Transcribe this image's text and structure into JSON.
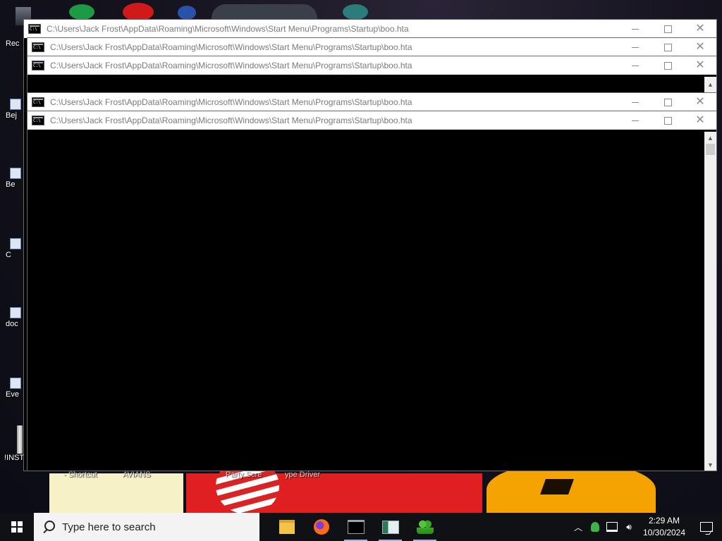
{
  "desktop": {
    "icons": [
      {
        "label": "Rec",
        "icon": "recycle-bin-icon"
      },
      {
        "label": "Bej",
        "icon": "shortcut-icon"
      },
      {
        "label": "Be",
        "icon": "shortcut-icon"
      },
      {
        "label": "C",
        "icon": "shortcut-icon"
      },
      {
        "label": "doc",
        "icon": "shortcut-icon"
      },
      {
        "label": "Eve",
        "icon": "shortcut-icon"
      },
      {
        "label": "!INST",
        "icon": "installer-icon"
      }
    ],
    "wallpaper_labels": [
      "- Shortcut",
      "AVIANS",
      "Party Scre",
      "ype Driver"
    ],
    "colors": {
      "wallpaper_red": "#e02020",
      "pumpkin": "#f5a300",
      "paper": "#f7f1c7"
    }
  },
  "windows": [
    {
      "title": "C:\\Users\\Jack Frost\\AppData\\Roaming\\Microsoft\\Windows\\Start Menu\\Programs\\Startup\\boo.hta"
    },
    {
      "title": "C:\\Users\\Jack Frost\\AppData\\Roaming\\Microsoft\\Windows\\Start Menu\\Programs\\Startup\\boo.hta"
    },
    {
      "title": "C:\\Users\\Jack Frost\\AppData\\Roaming\\Microsoft\\Windows\\Start Menu\\Programs\\Startup\\boo.hta"
    },
    {
      "title": "C:\\Users\\Jack Frost\\AppData\\Roaming\\Microsoft\\Windows\\Start Menu\\Programs\\Startup\\boo.hta"
    },
    {
      "title": "C:\\Users\\Jack Frost\\AppData\\Roaming\\Microsoft\\Windows\\Start Menu\\Programs\\Startup\\boo.hta"
    }
  ],
  "window_controls": {
    "minimize": "minimize-icon",
    "maximize": "maximize-icon",
    "close": "close-icon"
  },
  "taskbar": {
    "search_placeholder": "Type here to search",
    "apps": [
      {
        "name": "file-explorer-icon",
        "running": false
      },
      {
        "name": "firefox-icon",
        "running": false
      },
      {
        "name": "console-icon",
        "running": true
      },
      {
        "name": "app-window-icon",
        "running": true
      },
      {
        "name": "users-icon",
        "running": true
      }
    ],
    "tray": {
      "icons": [
        "chevron-up-icon",
        "people-icon",
        "network-icon",
        "volume-icon"
      ],
      "time": "2:29 AM",
      "date": "10/30/2024"
    }
  }
}
